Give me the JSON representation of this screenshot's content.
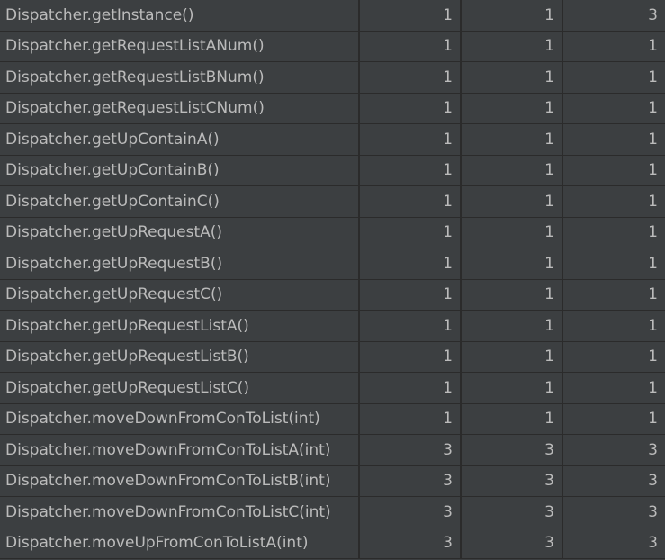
{
  "rows": [
    {
      "method": "Dispatcher.getInstance()",
      "values": [
        "1",
        "1",
        "3"
      ]
    },
    {
      "method": "Dispatcher.getRequestListANum()",
      "values": [
        "1",
        "1",
        "1"
      ]
    },
    {
      "method": "Dispatcher.getRequestListBNum()",
      "values": [
        "1",
        "1",
        "1"
      ]
    },
    {
      "method": "Dispatcher.getRequestListCNum()",
      "values": [
        "1",
        "1",
        "1"
      ]
    },
    {
      "method": "Dispatcher.getUpContainA()",
      "values": [
        "1",
        "1",
        "1"
      ]
    },
    {
      "method": "Dispatcher.getUpContainB()",
      "values": [
        "1",
        "1",
        "1"
      ]
    },
    {
      "method": "Dispatcher.getUpContainC()",
      "values": [
        "1",
        "1",
        "1"
      ]
    },
    {
      "method": "Dispatcher.getUpRequestA()",
      "values": [
        "1",
        "1",
        "1"
      ]
    },
    {
      "method": "Dispatcher.getUpRequestB()",
      "values": [
        "1",
        "1",
        "1"
      ]
    },
    {
      "method": "Dispatcher.getUpRequestC()",
      "values": [
        "1",
        "1",
        "1"
      ]
    },
    {
      "method": "Dispatcher.getUpRequestListA()",
      "values": [
        "1",
        "1",
        "1"
      ]
    },
    {
      "method": "Dispatcher.getUpRequestListB()",
      "values": [
        "1",
        "1",
        "1"
      ]
    },
    {
      "method": "Dispatcher.getUpRequestListC()",
      "values": [
        "1",
        "1",
        "1"
      ]
    },
    {
      "method": "Dispatcher.moveDownFromConToList(int)",
      "values": [
        "1",
        "1",
        "1"
      ]
    },
    {
      "method": "Dispatcher.moveDownFromConToListA(int)",
      "values": [
        "3",
        "3",
        "3"
      ]
    },
    {
      "method": "Dispatcher.moveDownFromConToListB(int)",
      "values": [
        "3",
        "3",
        "3"
      ]
    },
    {
      "method": "Dispatcher.moveDownFromConToListC(int)",
      "values": [
        "3",
        "3",
        "3"
      ]
    },
    {
      "method": "Dispatcher.moveUpFromConToListA(int)",
      "values": [
        "3",
        "3",
        "3"
      ]
    }
  ],
  "colors": {
    "cell_background": "#3c3f41",
    "grid_line": "#2b2b2b",
    "text": "#bbbbbb"
  }
}
